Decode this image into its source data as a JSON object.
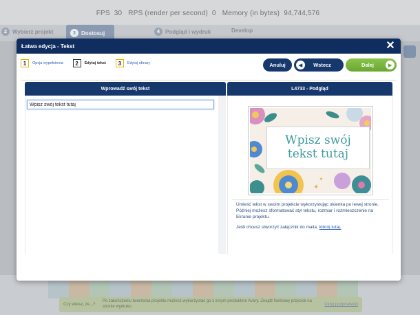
{
  "perf": {
    "fps_label": "FPS",
    "fps_value": "30",
    "rps_label": "RPS (render per second)",
    "rps_value": "0",
    "mem_label": "Memory (in bytes)",
    "mem_value": "94,744,576"
  },
  "bg_tabs": [
    {
      "num": "2",
      "label": "Wybierz projekt"
    },
    {
      "num": "3",
      "label": "Dostosuj"
    },
    {
      "num": "4",
      "label": "Podgląd i wydruk"
    },
    {
      "num": "",
      "label": "Develop"
    }
  ],
  "bg_tip": {
    "head": "Czy wiesz, że...?",
    "text": "Po zakończeniu tworzenia projektu możesz wykorzystać go z innym produktem Avery. Znajdź fioletowy przycisk na stronie wydruku.",
    "link": "Ukryj podpowiedzi"
  },
  "modal": {
    "title": "Łatwa edycja - Tekst",
    "close_glyph": "✕",
    "steps": [
      {
        "num": "1",
        "label": "Opcja wypełnienia"
      },
      {
        "num": "2",
        "label": "Edytuj tekst"
      },
      {
        "num": "3",
        "label": "Edytuj obrazy"
      }
    ],
    "buttons": {
      "cancel": "Anuluj",
      "back": "Wstecz",
      "next": "Dalej"
    },
    "left_header": "Wprowadź swój tekst",
    "input_value": "Wpisz swój tekst tutaj",
    "right_header": "L4733 - Podgląd",
    "preview_line1": "Wpisz swój",
    "preview_line2": "tekst tutaj",
    "info_p1": "Umieść tekst w swoim projekcie wykorzystując okienka po lewej stronie. Później możesz sformatować styl tekstu, rozmiar i rozmieszczenie na Ekranie projektu.",
    "info_p2_prefix": "Jeśli chcesz stworzyć załącznik do maila,",
    "info_p2_link": "kliknij tutaj."
  },
  "colors": {
    "header_navy": "#0f2d5e",
    "button_navy": "#17386d",
    "next_green": "#7ab83e",
    "preview_teal": "#3f9a9f"
  }
}
